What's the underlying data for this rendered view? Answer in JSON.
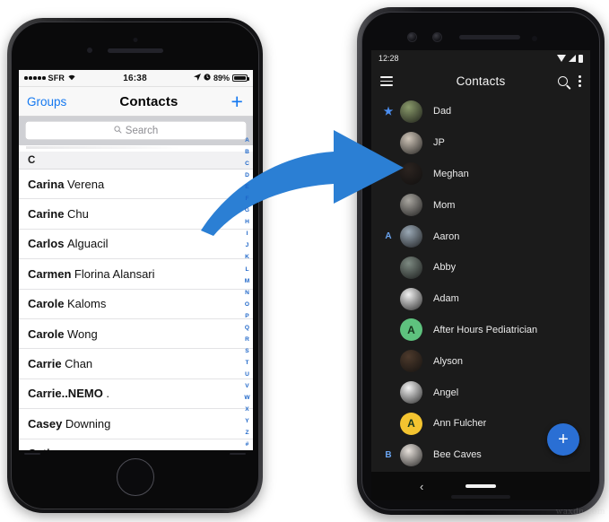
{
  "iphone": {
    "status": {
      "carrier": "SFR",
      "signal_dots": 5,
      "wifi_icon": "wifi-icon",
      "time": "16:38",
      "location_icon": "location-arrow-icon",
      "alarm_icon": "alarm-icon",
      "battery_pct": "89%"
    },
    "nav": {
      "back_label": "Groups",
      "title": "Contacts",
      "add_icon": "plus-icon"
    },
    "search": {
      "placeholder": "Search",
      "icon": "search-icon"
    },
    "section_header": "C",
    "contacts": [
      {
        "first": "Carina",
        "last": "Verena"
      },
      {
        "first": "Carine",
        "last": "Chu"
      },
      {
        "first": "Carlos",
        "last": "Alguacil"
      },
      {
        "first": "Carmen",
        "last": "Florina Alansari"
      },
      {
        "first": "Carole",
        "last": "Kaloms"
      },
      {
        "first": "Carole",
        "last": "Wong"
      },
      {
        "first": "Carrie",
        "last": "Chan"
      },
      {
        "first": "Carrie..NEMO",
        "last": "."
      },
      {
        "first": "Casey",
        "last": "Downing"
      },
      {
        "first": "Catia",
        "last": ""
      }
    ],
    "index": [
      "A",
      "B",
      "C",
      "D",
      "E",
      "F",
      "G",
      "H",
      "I",
      "J",
      "K",
      "L",
      "M",
      "N",
      "O",
      "P",
      "Q",
      "R",
      "S",
      "T",
      "U",
      "V",
      "W",
      "X",
      "Y",
      "Z",
      "#"
    ]
  },
  "android": {
    "status": {
      "time": "12:28",
      "wifi_icon": "wifi-icon",
      "signal_icon": "signal-icon",
      "battery_icon": "battery-icon"
    },
    "appbar": {
      "menu_icon": "hamburger-menu-icon",
      "title": "Contacts",
      "search_icon": "search-icon",
      "overflow_icon": "more-vert-icon"
    },
    "contacts": [
      {
        "gutter": "★",
        "gutter_type": "star",
        "name": "Dad",
        "avatar": "photo",
        "avatar_color": "#8a9a6b",
        "initial": ""
      },
      {
        "gutter": "",
        "gutter_type": "",
        "name": "JP",
        "avatar": "photo",
        "avatar_color": "#cfc5b8",
        "initial": ""
      },
      {
        "gutter": "",
        "gutter_type": "",
        "name": "Meghan",
        "avatar": "photo",
        "avatar_color": "#2c2420",
        "initial": ""
      },
      {
        "gutter": "",
        "gutter_type": "",
        "name": "Mom",
        "avatar": "photo",
        "avatar_color": "#a9a6a0",
        "initial": ""
      },
      {
        "gutter": "A",
        "gutter_type": "letter",
        "name": "Aaron",
        "avatar": "photo",
        "avatar_color": "#9aa8b5",
        "initial": ""
      },
      {
        "gutter": "",
        "gutter_type": "",
        "name": "Abby",
        "avatar": "photo",
        "avatar_color": "#7d8a82",
        "initial": ""
      },
      {
        "gutter": "",
        "gutter_type": "",
        "name": "Adam",
        "avatar": "photo",
        "avatar_color": "#f2f2f2",
        "initial": ""
      },
      {
        "gutter": "",
        "gutter_type": "",
        "name": "After Hours Pediatrician",
        "avatar": "initial",
        "avatar_color": "#5ec27e",
        "initial": "A"
      },
      {
        "gutter": "",
        "gutter_type": "",
        "name": "Alyson",
        "avatar": "photo",
        "avatar_color": "#4d3a2c",
        "initial": ""
      },
      {
        "gutter": "",
        "gutter_type": "",
        "name": "Angel",
        "avatar": "photo",
        "avatar_color": "#f4f4f4",
        "initial": ""
      },
      {
        "gutter": "",
        "gutter_type": "",
        "name": "Ann Fulcher",
        "avatar": "initial",
        "avatar_color": "#f4c430",
        "initial": "A"
      },
      {
        "gutter": "B",
        "gutter_type": "letter",
        "name": "Bee Caves",
        "avatar": "photo",
        "avatar_color": "#e8e2dc",
        "initial": ""
      }
    ],
    "fab": {
      "icon": "plus-icon",
      "label": "+",
      "color": "#2a6fd4"
    },
    "navbar": {
      "back_icon": "chevron-left-icon",
      "back_label": "‹",
      "home_pill": "home-pill"
    }
  },
  "arrow": {
    "color": "#2b7fd4",
    "direction": "left-to-right"
  },
  "watermark": "waxdn.com"
}
